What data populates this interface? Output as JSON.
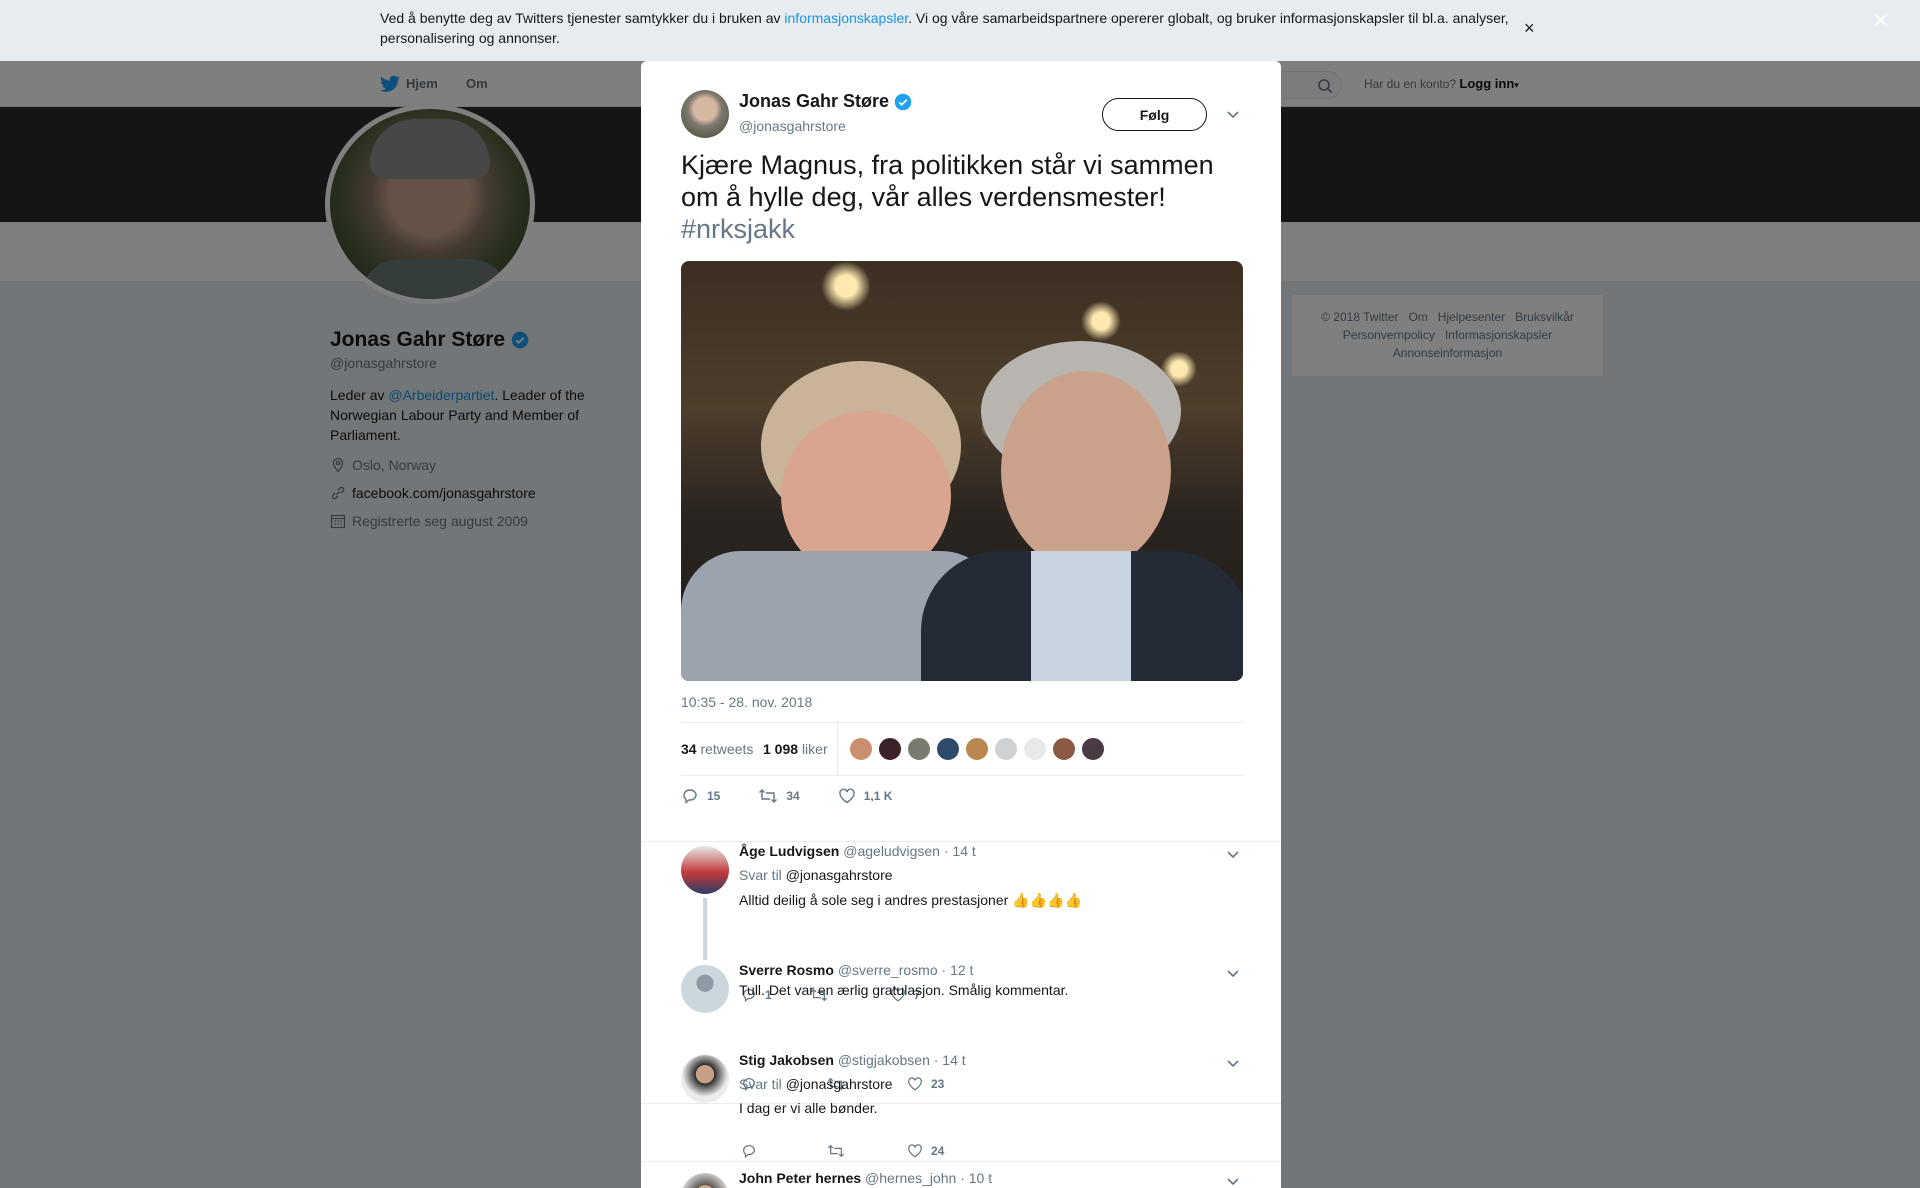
{
  "cookie": {
    "text_before": "Ved å benytte deg av Twitters tjenester samtykker du i bruken av ",
    "link": "informasjonskapsler",
    "text_after": ". Vi og våre samarbeidspartnere opererer globalt, og bruker informasjonskapsler til bl.a. analyser, personalisering og annonser.",
    "close": "×"
  },
  "nav": {
    "home": "Hjem",
    "about": "Om",
    "account_prompt": "Har du en konto?",
    "login": "Logg inn"
  },
  "profile": {
    "name": "Jonas Gahr Støre",
    "handle": "@jonasgahrstore",
    "bio_before": "Leder av ",
    "bio_link": "@Arbeiderpartiet",
    "bio_after": ". Leader of the Norwegian Labour Party and Member of Parliament.",
    "location": "Oslo, Norway",
    "website": "facebook.com/jonasgahrstore",
    "joined": "Registrerte seg august 2009"
  },
  "footer": {
    "copyright": "© 2018 Twitter",
    "about": "Om",
    "help": "Hjelpesenter",
    "terms": "Bruksvilkår",
    "privacy": "Personvernpolicy",
    "cookies": "Informasjonskapsler",
    "ads": "Annonseinformasjon"
  },
  "modal": {
    "close": "×",
    "tweet": {
      "name": "Jonas Gahr Støre",
      "handle": "@jonasgahrstore",
      "follow": "Følg",
      "text": "Kjære Magnus, fra politikken står vi sammen om å hylle deg, vår alles verdensmester!",
      "hashtag": "#nrksjakk",
      "time": "10:35 - 28. nov. 2018",
      "retweets_count": "34",
      "retweets_label": "retweets",
      "likes_count": "1 098",
      "likes_label": "liker",
      "reply_count": "15",
      "retweet_count": "34",
      "like_count": "1,1 K"
    },
    "replies": [
      {
        "name": "Åge Ludvigsen",
        "handle": "@ageludvigsen",
        "time": "· 14 t",
        "reply_to_label": "Svar til",
        "reply_to": "@jonasgahrstore",
        "text": "Alltid deilig å sole seg i andres prestasjoner 👍👍👍👍",
        "replies": "1",
        "retweets": "",
        "likes": "7"
      },
      {
        "name": "Sverre Rosmo",
        "handle": "@sverre_rosmo",
        "time": "· 12 t",
        "text": "Tull. Det var en ærlig gratulasjon. Smålig kommentar.",
        "replies": "",
        "retweets": "",
        "likes": "23"
      },
      {
        "name": "Stig Jakobsen",
        "handle": "@stigjakobsen",
        "time": "· 14 t",
        "reply_to_label": "Svar til",
        "reply_to": "@jonasgahrstore",
        "text": "I dag er vi alle bønder.",
        "replies": "",
        "retweets": "",
        "likes": "24"
      },
      {
        "name": "John Peter hernes",
        "handle": "@hernes_john",
        "time": "· 10 t"
      }
    ]
  },
  "colors": {
    "link": "#1b95e0",
    "verified": "#1da1f2",
    "muted": "#657786",
    "text": "#14171a"
  }
}
